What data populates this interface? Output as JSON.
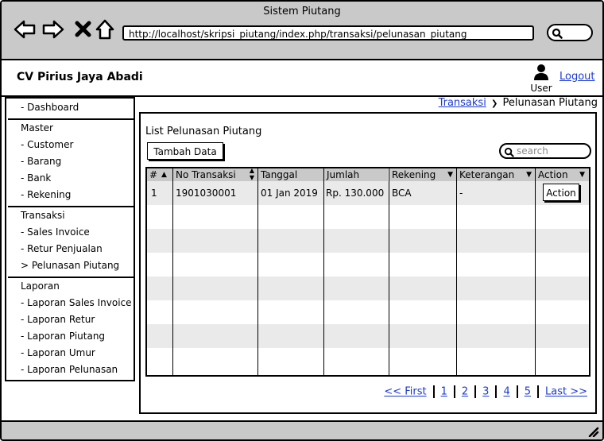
{
  "browser": {
    "window_title": "Sistem Piutang",
    "url": "http://localhost/skripsi_piutang/index.php/transaksi/pelunasan_piutang"
  },
  "header": {
    "company": "CV Pirius Jaya Abadi",
    "user_label": "User",
    "logout_label": "Logout"
  },
  "sidebar": {
    "dashboard": "- Dashboard",
    "master_heading": "Master",
    "master_items": [
      "- Customer",
      "- Barang",
      "- Bank",
      "- Rekening"
    ],
    "transaksi_heading": "Transaksi",
    "transaksi_items": [
      "- Sales Invoice",
      "- Retur Penjualan",
      "> Pelunasan Piutang"
    ],
    "laporan_heading": "Laporan",
    "laporan_items": [
      "- Laporan Sales Invoice",
      "- Laporan Retur",
      "- Laporan Piutang",
      "- Laporan Umur",
      "- Laporan Pelunasan"
    ]
  },
  "breadcrumb": {
    "parent": "Transaksi",
    "separator": "❯",
    "current": "Pelunasan Piutang"
  },
  "main": {
    "title": "List Pelunasan Piutang",
    "add_button": "Tambah Data",
    "search_placeholder": "search"
  },
  "table": {
    "columns": [
      "#",
      "No Transaksi",
      "Tanggal",
      "Jumlah",
      "Rekening",
      "Keterangan",
      "Action"
    ],
    "rows": [
      {
        "no": "1",
        "no_transaksi": "1901030001",
        "tanggal": "01 Jan 2019",
        "jumlah": "Rp. 130.000",
        "rekening": "BCA",
        "keterangan": "-",
        "action": "Action"
      }
    ]
  },
  "pagination": {
    "first": "<< First",
    "pages": [
      "1",
      "2",
      "3",
      "4",
      "5"
    ],
    "last": "Last >>"
  },
  "colors": {
    "chrome": "#c9c9c9",
    "link": "#1a3ad6",
    "stripe": "#eaeaea"
  }
}
